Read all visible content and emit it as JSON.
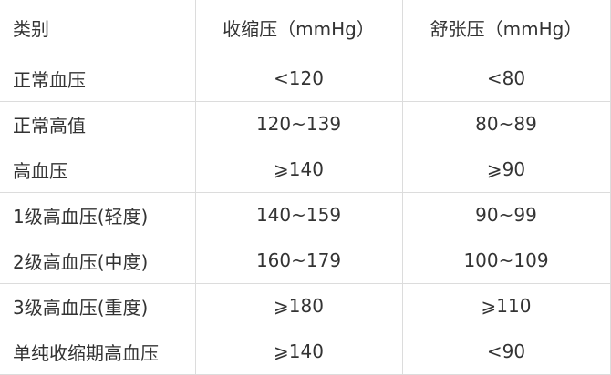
{
  "table": {
    "headers": [
      "类别",
      "收缩压（mmHg）",
      "舒张压（mmHg）"
    ],
    "rows": [
      [
        "正常血压",
        "<120",
        "<80"
      ],
      [
        "正常高值",
        "120~139",
        "80~89"
      ],
      [
        "高血压",
        "⩾140",
        "⩾90"
      ],
      [
        "1级高血压(轻度)",
        "140~159",
        "90~99"
      ],
      [
        "2级高血压(中度)",
        "160~179",
        "100~109"
      ],
      [
        "3级高血压(重度)",
        "⩾180",
        "⩾110"
      ],
      [
        "单纯收缩期高血压",
        "⩾140",
        "<90"
      ]
    ]
  }
}
